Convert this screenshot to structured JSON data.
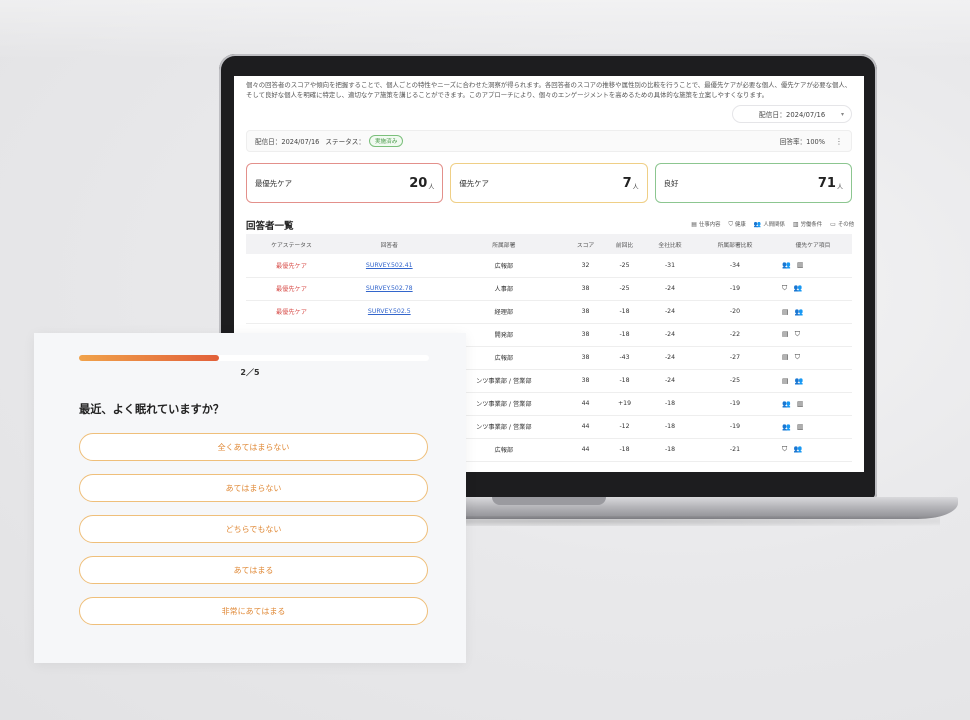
{
  "dashboard": {
    "intro_text": "個々の回答者のスコアや傾向を把握することで、個人ごとの特性やニーズに合わせた洞察が得られます。各回答者のスコアの推移や属性別の比較を行うことで、最優先ケアが必要な個人、優先ケアが必要な個人、そして良好な個人を明確に特定し、適切なケア施策を講じることができます。このアプローチにより、個々のエンゲージメントを高めるための具体的な施策を立案しやすくなります。",
    "date_select": "配信日：2024/07/16",
    "info_bar": {
      "date": "配信日：2024/07/16",
      "status_label": "ステータス：",
      "status_badge": "実施済み",
      "response_rate": "回答率：100%"
    },
    "cards": [
      {
        "label": "最優先ケア",
        "value": "20",
        "unit": "人"
      },
      {
        "label": "優先ケア",
        "value": "7",
        "unit": "人"
      },
      {
        "label": "良好",
        "value": "71",
        "unit": "人"
      }
    ],
    "list_title": "回答者一覧",
    "legend": [
      {
        "icon": "document-icon",
        "glyph": "▤",
        "label": "仕事内容"
      },
      {
        "icon": "shield-icon",
        "glyph": "⛉",
        "label": "健康"
      },
      {
        "icon": "people-icon",
        "glyph": "👥",
        "label": "人間関係"
      },
      {
        "icon": "building-icon",
        "glyph": "▥",
        "label": "労働条件"
      },
      {
        "icon": "comment-icon",
        "glyph": "▭",
        "label": "その他"
      }
    ],
    "table": {
      "headers": [
        "ケアステータス",
        "回答者",
        "所属部署",
        "スコア",
        "前回比",
        "全社比較",
        "所属部署比較",
        "優先ケア項目"
      ],
      "rows": [
        [
          "最優先ケア",
          "SURVEY.502.41",
          "広報部",
          "32",
          "-25",
          "-31",
          "-34",
          "👥 ▥"
        ],
        [
          "最優先ケア",
          "SURVEY.502.78",
          "人事部",
          "38",
          "-25",
          "-24",
          "-19",
          "⛉ 👥"
        ],
        [
          "最優先ケア",
          "SURVEY.502.5",
          "経理部",
          "38",
          "-18",
          "-24",
          "-20",
          "▤ 👥"
        ],
        [
          "",
          "",
          "開発部",
          "38",
          "-18",
          "-24",
          "-22",
          "▤ ⛉"
        ],
        [
          "",
          "",
          "広報部",
          "38",
          "-43",
          "-24",
          "-27",
          "▤ ⛉"
        ],
        [
          "",
          "",
          "ンツ事業部 / 営業部",
          "38",
          "-18",
          "-24",
          "-25",
          "▤ 👥"
        ],
        [
          "",
          "",
          "ンツ事業部 / 営業部",
          "44",
          "+19",
          "-18",
          "-19",
          "👥 ▥"
        ],
        [
          "",
          "",
          "ンツ事業部 / 営業部",
          "44",
          "-12",
          "-18",
          "-19",
          "👥 ▥"
        ],
        [
          "",
          "",
          "広報部",
          "44",
          "-18",
          "-18",
          "-21",
          "⛉ 👥"
        ]
      ]
    }
  },
  "survey": {
    "progress_fraction": 0.4,
    "step": "2／5",
    "question": "最近、よく眠れていますか？",
    "options": [
      "全くあてはまらない",
      "あてはまらない",
      "どちらでもない",
      "あてはまる",
      "非常にあてはまる"
    ]
  }
}
